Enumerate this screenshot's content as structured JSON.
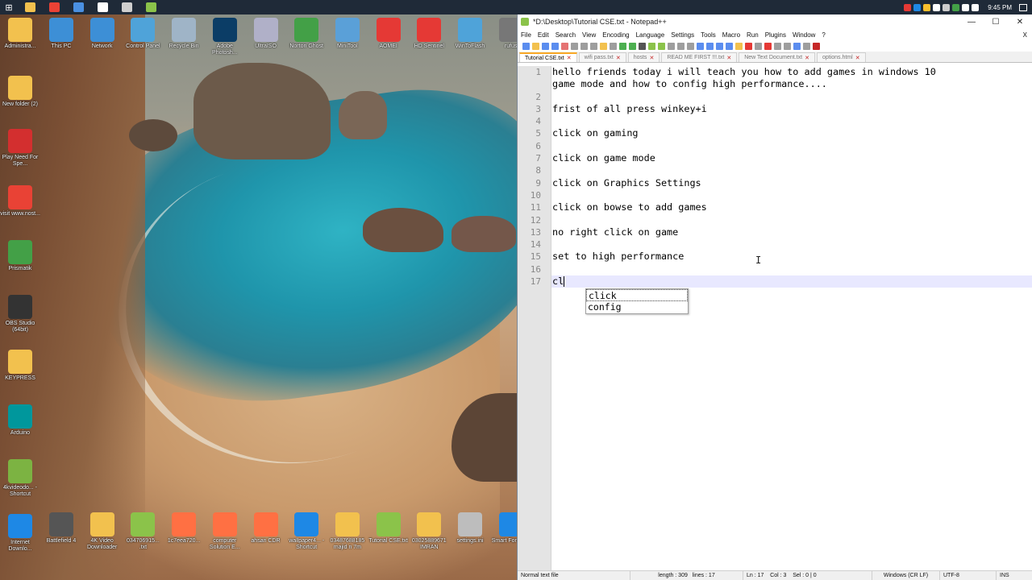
{
  "taskbar": {
    "clock": "9:45 PM",
    "apps": [
      {
        "name": "start-button",
        "color": "#ffffff"
      },
      {
        "name": "file-explorer",
        "color": "#f2c14e"
      },
      {
        "name": "chrome",
        "color": "#e94235"
      },
      {
        "name": "cortana",
        "color": "#4a90e2"
      },
      {
        "name": "app-4",
        "color": "#ffffff"
      },
      {
        "name": "app-5",
        "color": "#cfcfcf"
      },
      {
        "name": "notepad-plus-plus",
        "color": "#8bc34a"
      }
    ]
  },
  "desktop": {
    "icons_left": [
      {
        "label": "Administra...",
        "icon": "folder-user-icon",
        "color": "#f2c14e"
      },
      {
        "label": "New folder (2)",
        "icon": "folder-icon",
        "color": "#f2c14e"
      },
      {
        "label": "Play Need For Spe...",
        "icon": "nfs-icon",
        "color": "#d32f2f"
      },
      {
        "label": "visit www.nost...",
        "icon": "chrome-icon",
        "color": "#e94235"
      },
      {
        "label": "Prismatik",
        "icon": "prismatik-icon",
        "color": "#43a047"
      },
      {
        "label": "OBS Studio (64bit)",
        "icon": "obs-icon",
        "color": "#333333"
      },
      {
        "label": "KEYPRESS",
        "icon": "document-icon",
        "color": "#f2c14e"
      },
      {
        "label": "Arduino",
        "icon": "arduino-icon",
        "color": "#00979c"
      },
      {
        "label": "4kvideodo... - Shortcut",
        "icon": "download-icon",
        "color": "#7cb342"
      },
      {
        "label": "Internet Downlo...",
        "icon": "idm-icon",
        "color": "#1e88e5"
      }
    ],
    "icons_top": [
      {
        "label": "This PC",
        "icon": "pc-icon",
        "color": "#3d8fd6"
      },
      {
        "label": "Network",
        "icon": "network-icon",
        "color": "#3d8fd6"
      },
      {
        "label": "Control Panel",
        "icon": "control-panel-icon",
        "color": "#4fa3d9"
      },
      {
        "label": "Recycle Bin",
        "icon": "recycle-bin-icon",
        "color": "#9fb4c7"
      },
      {
        "label": "Adobe Photosh...",
        "icon": "photoshop-icon",
        "color": "#0b3d66"
      },
      {
        "label": "UltraISO",
        "icon": "disc-icon",
        "color": "#b0b0c8"
      },
      {
        "label": "Norton Ghost",
        "icon": "ghost-icon",
        "color": "#43a047"
      },
      {
        "label": "MiniTool",
        "icon": "minitool-icon",
        "color": "#5aa0d8"
      },
      {
        "label": "AOMEI",
        "icon": "aomei-icon",
        "color": "#e53935"
      },
      {
        "label": "HD Sentinel",
        "icon": "hdd-icon",
        "color": "#e53935"
      },
      {
        "label": "WinToFlash",
        "icon": "flash-icon",
        "color": "#4fa3d9"
      },
      {
        "label": "rufus",
        "icon": "usb-icon",
        "color": "#777777"
      }
    ],
    "icons_bottom": [
      {
        "label": "Battlefield 4",
        "icon": "game-icon",
        "color": "#555555"
      },
      {
        "label": "4K Video Downloader",
        "icon": "document-icon",
        "color": "#f2c14e"
      },
      {
        "label": "034706915... .txt",
        "icon": "notepad-icon",
        "color": "#8bc34a"
      },
      {
        "label": "1c7eea720...",
        "icon": "balloon-icon",
        "color": "#ff7043"
      },
      {
        "label": "computer Solution E...",
        "icon": "balloon-icon",
        "color": "#ff7043"
      },
      {
        "label": "ahsan CDR",
        "icon": "balloon-icon",
        "color": "#ff7043"
      },
      {
        "label": "wallpaper4... - Shortcut",
        "icon": "settings-icon",
        "color": "#1e88e5"
      },
      {
        "label": "03487688185 majid n 7m",
        "icon": "folder-icon",
        "color": "#f2c14e"
      },
      {
        "label": "Tutorial CSE.txt",
        "icon": "notepad-icon",
        "color": "#8bc34a"
      },
      {
        "label": "03025889671 IMRAN",
        "icon": "folder-icon",
        "color": "#f2c14e"
      },
      {
        "label": "settings.ini",
        "icon": "gear-file-icon",
        "color": "#bdbdbd"
      },
      {
        "label": "Smart Forwar...",
        "icon": "globe-icon",
        "color": "#1e88e5"
      }
    ]
  },
  "window": {
    "title": "*D:\\Desktop\\Tutorial CSE.txt - Notepad++",
    "menu": [
      "File",
      "Edit",
      "Search",
      "View",
      "Encoding",
      "Language",
      "Settings",
      "Tools",
      "Macro",
      "Run",
      "Plugins",
      "Window",
      "?"
    ],
    "close_doc": "X",
    "tabs": [
      {
        "label": "Tutorial CSE.txt",
        "active": true
      },
      {
        "label": "wifi pass.txt",
        "active": false
      },
      {
        "label": "hosts",
        "active": false
      },
      {
        "label": "READ ME FIRST !!!.txt",
        "active": false
      },
      {
        "label": "New Text Document.txt",
        "active": false
      },
      {
        "label": "options.html",
        "active": false
      }
    ],
    "line_numbers": [
      "1",
      "",
      "2",
      "3",
      "4",
      "5",
      "6",
      "7",
      "8",
      "9",
      "10",
      "11",
      "12",
      "13",
      "14",
      "15",
      "16",
      "17"
    ],
    "lines": [
      "hello friends today i will teach you how to add games in windows 10",
      "game mode and how to config high performance....",
      "",
      "frist of all press winkey+i",
      "",
      "click on gaming",
      "",
      "click on game mode",
      "",
      "click on Graphics Settings",
      "",
      "click on bowse to add games",
      "",
      "no right click on game",
      "",
      "set to high performance",
      "",
      "cl"
    ],
    "autocomplete": [
      "click",
      "config"
    ],
    "status": {
      "file_type": "Normal text file",
      "length": "length : 309",
      "lines": "lines : 17",
      "position": "Ln : 17    Col : 3    Sel : 0 | 0",
      "eol": "Windows (CR LF)",
      "encoding": "UTF-8",
      "mode": "INS"
    }
  }
}
